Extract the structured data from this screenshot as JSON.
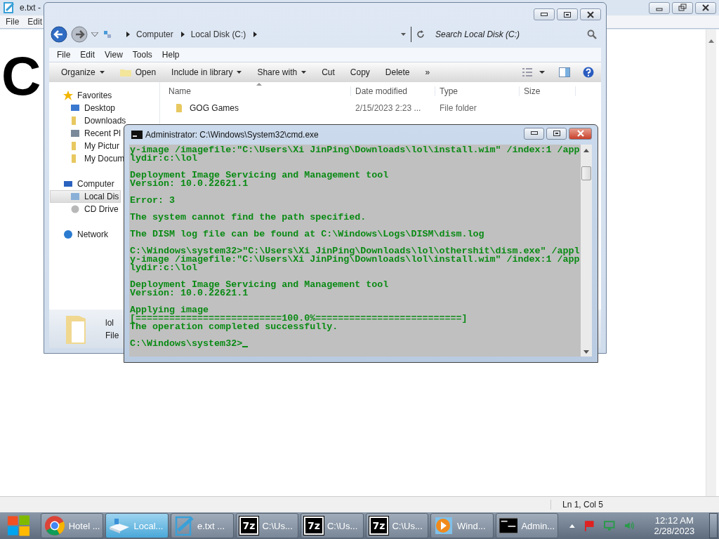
{
  "notepad": {
    "title": "e.txt -",
    "menu": [
      "File",
      "Edit"
    ],
    "content": "C",
    "status": "Ln 1, Col 5"
  },
  "explorer": {
    "breadcrumb": [
      "Computer",
      "Local Disk (C:)"
    ],
    "search": {
      "placeholder": "Search Local Disk (C:)"
    },
    "menu": [
      "File",
      "Edit",
      "View",
      "Tools",
      "Help"
    ],
    "toolbar": [
      {
        "label": "Organize",
        "kind": "text",
        "dropdown": true
      },
      {
        "label": "Open",
        "kind": "open",
        "dropdown": false
      },
      {
        "label": "Include in library",
        "kind": "text",
        "dropdown": true
      },
      {
        "label": "Share with",
        "kind": "text",
        "dropdown": true
      },
      {
        "label": "Cut",
        "kind": "text",
        "dropdown": false
      },
      {
        "label": "Copy",
        "kind": "text",
        "dropdown": false
      },
      {
        "label": "Delete",
        "kind": "text",
        "dropdown": false
      },
      {
        "label": "»",
        "kind": "text",
        "dropdown": false
      }
    ],
    "nav": [
      {
        "label": "Favorites",
        "kind": "star",
        "selected": false,
        "children": [
          {
            "label": "Desktop",
            "kind": "desktop",
            "selected": false
          },
          {
            "label": "Downloads",
            "kind": "folder",
            "selected": false
          },
          {
            "label": "Recent Pl",
            "kind": "recent",
            "selected": false
          },
          {
            "label": "My Pictur",
            "kind": "folder",
            "selected": false
          },
          {
            "label": "My Docum",
            "kind": "folder",
            "selected": false
          }
        ]
      },
      {
        "label": "Computer",
        "kind": "computer",
        "selected": false,
        "children": [
          {
            "label": "Local Dis",
            "kind": "drive",
            "selected": true
          },
          {
            "label": "CD Drive",
            "kind": "cd",
            "selected": false
          }
        ]
      },
      {
        "label": "Network",
        "kind": "network",
        "selected": false
      }
    ],
    "columns": [
      "Name",
      "Date modified",
      "Type",
      "Size"
    ],
    "rows": [
      {
        "name": "GOG Games",
        "date": "2/15/2023 2:23 ...",
        "type": "File folder"
      }
    ],
    "details": {
      "name": "lol",
      "type": "File"
    }
  },
  "cmd": {
    "title": "Administrator: C:\\Windows\\System32\\cmd.exe",
    "blocks": [
      [
        "y-image /imagefile:\"C:\\Users\\Xi JinPing\\Downloads\\lol\\install.wim\" /index:1 /app",
        "lydir:c:\\lol"
      ],
      [
        "Deployment Image Servicing and Management tool",
        "Version: 10.0.22621.1"
      ],
      [
        "Error: 3"
      ],
      [
        "The system cannot find the path specified."
      ],
      [
        "The DISM log file can be found at C:\\Windows\\Logs\\DISM\\dism.log"
      ],
      [
        "C:\\Windows\\system32>\"C:\\Users\\Xi JinPing\\Downloads\\lol\\othershit\\dism.exe\" /appl",
        "y-image /imagefile:\"C:\\Users\\Xi JinPing\\Downloads\\lol\\install.wim\" /index:1 /app",
        "lydir:c:\\lol"
      ],
      [
        "Deployment Image Servicing and Management tool",
        "Version: 10.0.22621.1"
      ],
      [
        "Applying image",
        "[==========================100.0%==========================]",
        "The operation completed successfully."
      ],
      [
        "C:\\Windows\\system32>"
      ]
    ]
  },
  "taskbar": {
    "tasks": [
      {
        "kind": "chrome",
        "label": "Hotel ...",
        "selected": false
      },
      {
        "kind": "explorer",
        "label": "Local...",
        "selected": true
      },
      {
        "kind": "notepad",
        "label": "e.txt ...",
        "selected": false
      },
      {
        "kind": "archive",
        "icon_text": "7z",
        "label": "C:\\Us...",
        "selected": false
      },
      {
        "kind": "archive",
        "icon_text": "7z",
        "label": "C:\\Us...",
        "selected": false
      },
      {
        "kind": "archive",
        "icon_text": "7z",
        "label": "C:\\Us...",
        "selected": false
      },
      {
        "kind": "media",
        "label": "Wind...",
        "selected": false
      },
      {
        "kind": "console",
        "label": "Admin...",
        "selected": false
      }
    ],
    "clock": {
      "time": "12:12 AM",
      "date": "2/28/2023"
    }
  }
}
